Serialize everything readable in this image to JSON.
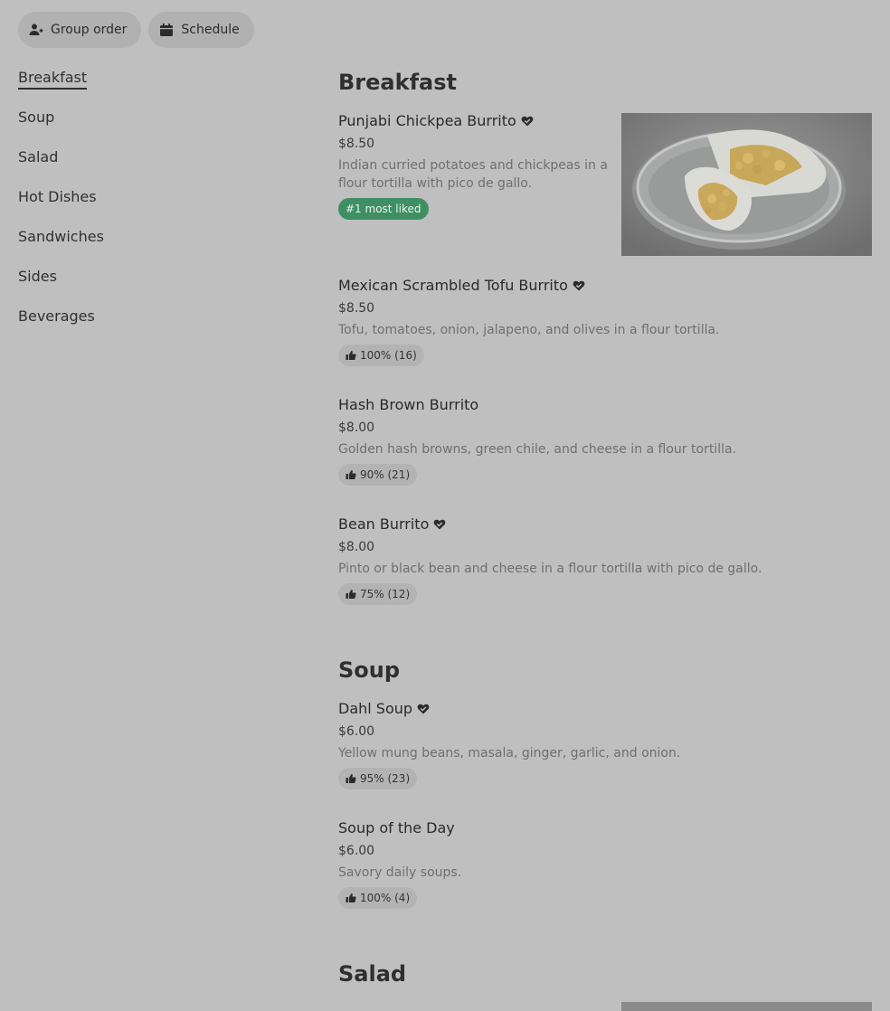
{
  "topbar": {
    "group_order": "Group order",
    "schedule": "Schedule"
  },
  "sidebar": {
    "items": [
      {
        "label": "Breakfast"
      },
      {
        "label": "Soup"
      },
      {
        "label": "Salad"
      },
      {
        "label": "Hot Dishes"
      },
      {
        "label": "Sandwiches"
      },
      {
        "label": "Sides"
      },
      {
        "label": "Beverages"
      }
    ]
  },
  "sections": {
    "breakfast": {
      "title": "Breakfast",
      "items": [
        {
          "name": "Punjabi Chickpea Burrito",
          "price": "$8.50",
          "desc": "Indian curried potatoes and chickpeas in a flour tortilla with pico de gallo.",
          "badge": "#1 most liked",
          "favorite": true
        },
        {
          "name": "Mexican Scrambled Tofu Burrito",
          "price": "$8.50",
          "desc": "Tofu, tomatoes, onion, jalapeno, and olives in a flour tortilla.",
          "badge": "100% (16)",
          "favorite": true
        },
        {
          "name": "Hash Brown Burrito",
          "price": "$8.00",
          "desc": "Golden hash browns, green chile, and cheese in a flour tortilla.",
          "badge": "90% (21)",
          "favorite": false
        },
        {
          "name": "Bean Burrito",
          "price": "$8.00",
          "desc": "Pinto or black bean and cheese in a flour tortilla with pico de gallo.",
          "badge": "75% (12)",
          "favorite": true
        }
      ]
    },
    "soup": {
      "title": "Soup",
      "items": [
        {
          "name": "Dahl Soup",
          "price": "$6.00",
          "desc": "Yellow mung beans, masala, ginger, garlic, and onion.",
          "badge": "95% (23)",
          "favorite": true
        },
        {
          "name": "Soup of the Day",
          "price": "$6.00",
          "desc": "Savory daily soups.",
          "badge": "100% (4)",
          "favorite": false
        }
      ]
    },
    "salad": {
      "title": "Salad"
    }
  },
  "colors": {
    "background": "#bfbfbf",
    "most_liked_badge": "#3f8f63"
  },
  "icons": {
    "group_order": "person-add-icon",
    "schedule": "calendar-icon",
    "favorite": "heart-icon",
    "rating": "thumbs-up-icon"
  }
}
